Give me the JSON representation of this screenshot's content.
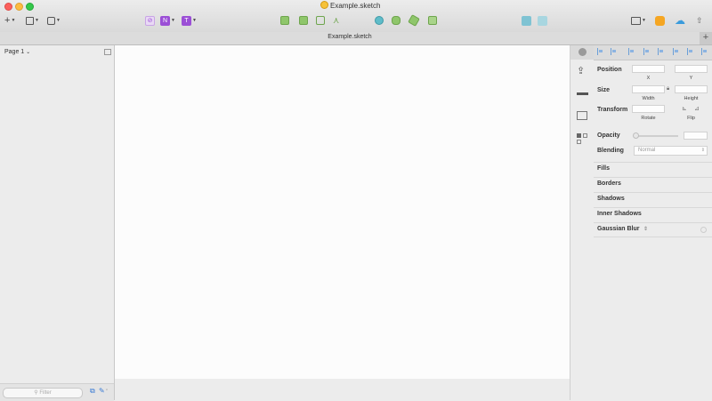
{
  "window": {
    "title": "Example.sketch"
  },
  "tab": {
    "title": "Example.sketch",
    "new_tab": "+"
  },
  "left_panel": {
    "page_selector": "Page 1",
    "filter_placeholder": "Filter"
  },
  "inspector": {
    "position": {
      "label": "Position",
      "x_label": "X",
      "y_label": "Y"
    },
    "size": {
      "label": "Size",
      "width_label": "Width",
      "height_label": "Height"
    },
    "transform": {
      "label": "Transform",
      "rotate_label": "Rotate",
      "flip_label": "Flip"
    },
    "opacity": {
      "label": "Opacity"
    },
    "blending": {
      "label": "Blending",
      "value": "Normal"
    },
    "sections": [
      "Fills",
      "Borders",
      "Shadows",
      "Inner Shadows",
      "Gaussian Blur"
    ]
  },
  "colors": {
    "accent": "#9b4fd6",
    "close": "#fc605c",
    "minimize": "#fdbc40",
    "maximize": "#34c84a",
    "canvas": "#fcfcfc"
  },
  "icons": {
    "toolbar_left": [
      "insert-icon",
      "group-icon",
      "symbol-icon"
    ],
    "toolbar_purple": [
      "edit-icon",
      "vector-icon",
      "text-icon"
    ],
    "toolbar_green": [
      "union-icon",
      "subtract-icon",
      "intersect-icon",
      "difference-icon"
    ],
    "toolbar_teal": [
      "flatten-icon",
      "scissors-icon",
      "rotate-icon",
      "mask-icon"
    ],
    "toolbar_right": [
      "forward-icon",
      "backward-icon",
      "view-icon",
      "cloud-icon",
      "export-icon"
    ]
  }
}
